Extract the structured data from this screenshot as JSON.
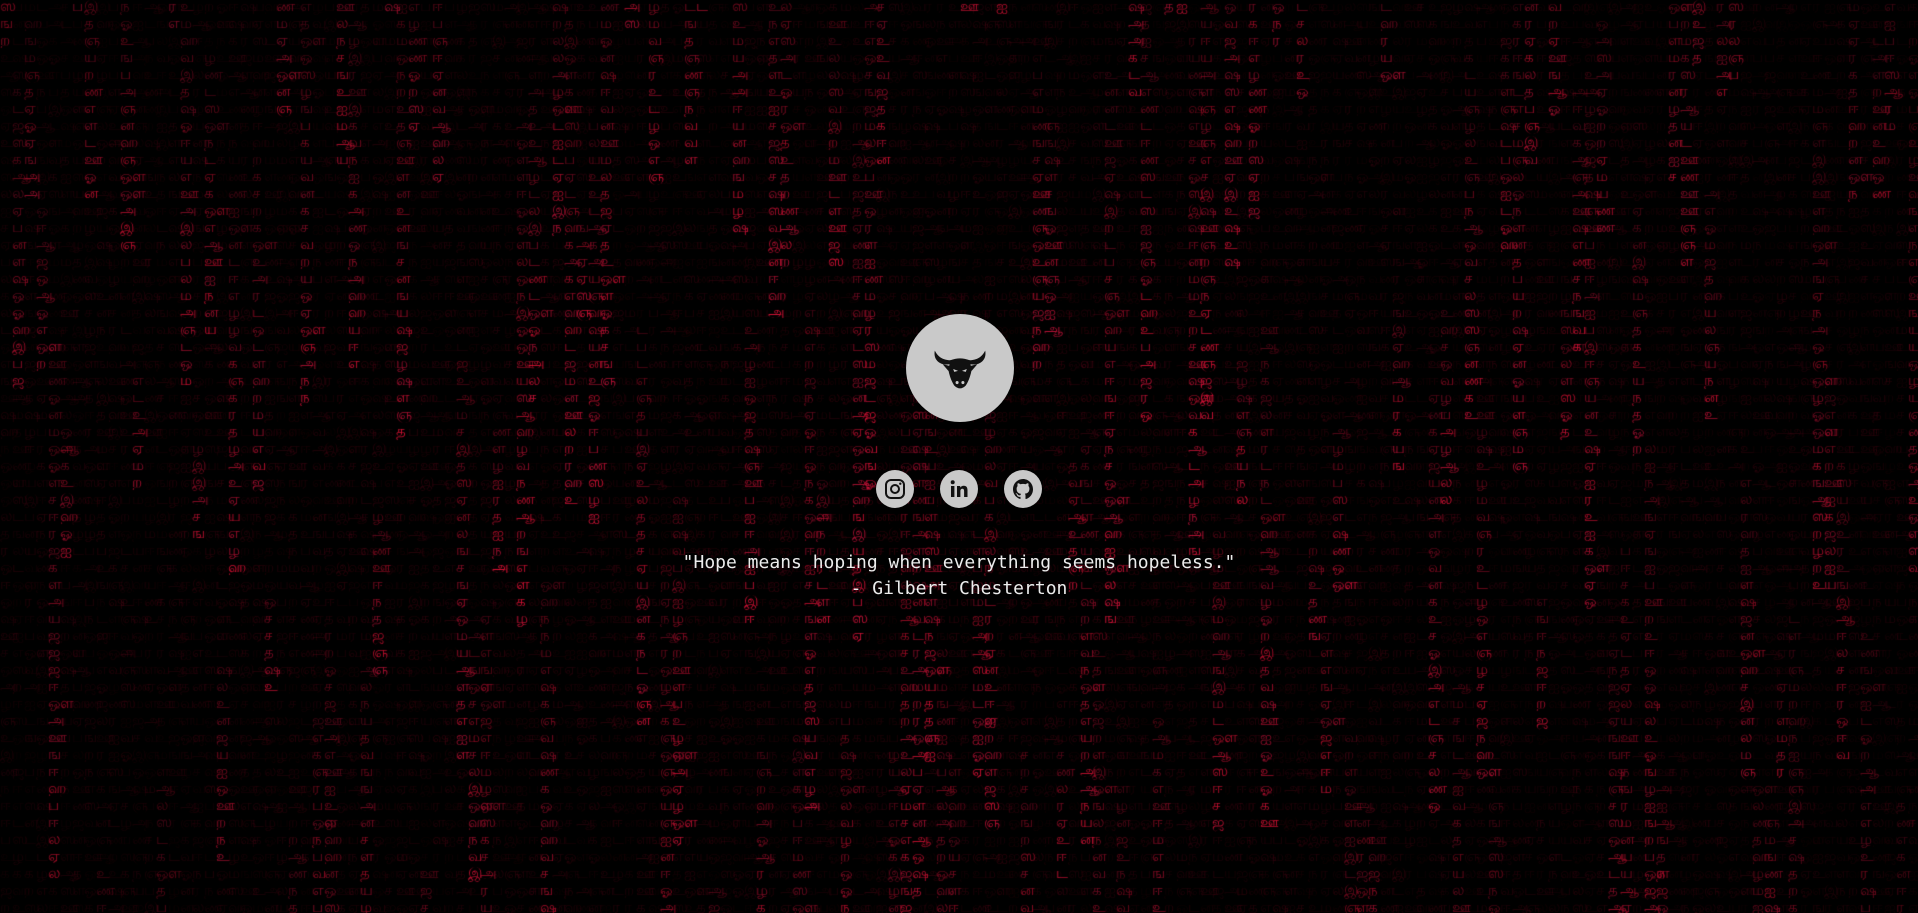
{
  "page": {
    "background_color": "#000000",
    "rain_color": "#ff1e46",
    "rain_glyphs": "அஆஇஈஉஊஎஏஐஒஓஔகஙசஞடணதநபமயரலவழளறனஜஷஸஹ"
  },
  "profile": {
    "avatar_icon": "bull-head-icon",
    "avatar_bg": "#c9c9c9"
  },
  "socials": [
    {
      "name": "instagram",
      "icon": "instagram-icon"
    },
    {
      "name": "linkedin",
      "icon": "linkedin-icon"
    },
    {
      "name": "github",
      "icon": "github-icon"
    }
  ],
  "quote": {
    "text": "\"Hope means hoping when everything seems hopeless.\"",
    "author": "- Gilbert Chesterton"
  }
}
